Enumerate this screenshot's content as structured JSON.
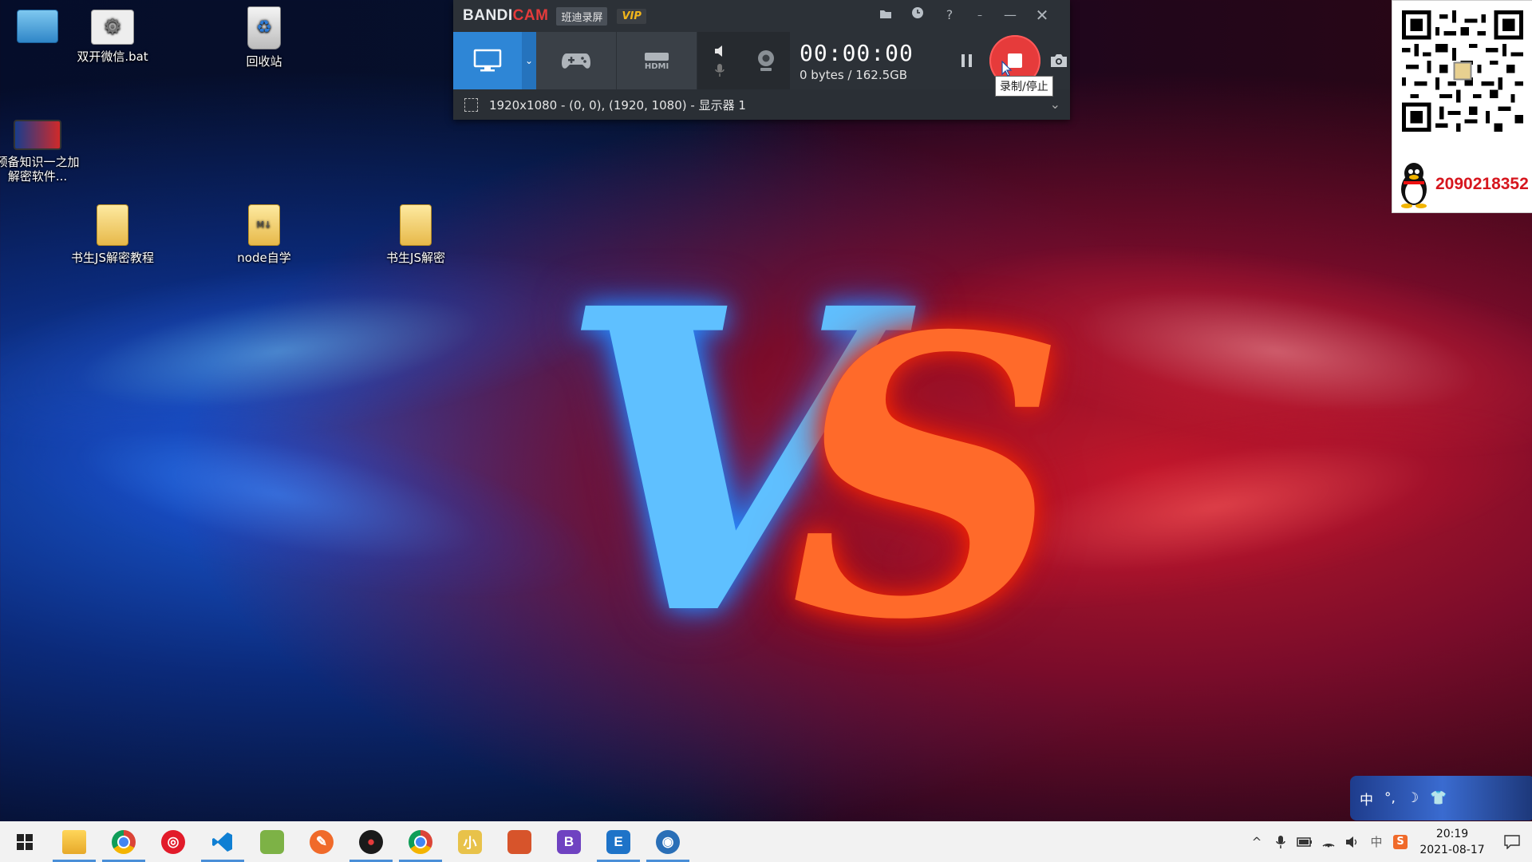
{
  "desktop": {
    "icons": [
      {
        "label": ""
      },
      {
        "label": "双开微信.bat"
      },
      {
        "label": "回收站"
      },
      {
        "label": "预备知识一之加解密软件..."
      },
      {
        "label": "书生JS解密教程"
      },
      {
        "label": "node自学"
      },
      {
        "label": "书生JS解密"
      }
    ],
    "wallpaper_text": "VS"
  },
  "bandicam": {
    "brand_a": "BANDI",
    "brand_b": "CAM",
    "tag": "班迪录屏",
    "vip": "VIP",
    "timer": "00:00:00",
    "size": "0 bytes / 162.5GB",
    "region": "1920x1080 - (0, 0), (1920, 1080) - 显示器 1",
    "tooltip": "录制/停止",
    "modes": [
      "screen-mode",
      "game-mode",
      "hdmi-mode"
    ],
    "hdmi_label": "HDMI"
  },
  "qr_panel": {
    "qq_number": "2090218352"
  },
  "ime": {
    "lang": "中"
  },
  "taskbar": {
    "clock_time": "20:19",
    "clock_date": "2021-08-17",
    "tray_lang": "中",
    "apps": [
      {
        "name": "file-explorer",
        "color": "#f4c430",
        "glyph": "",
        "running": true
      },
      {
        "name": "chrome",
        "color": "#ffffff",
        "glyph": "",
        "running": true
      },
      {
        "name": "netease-music",
        "color": "#e21b2a",
        "glyph": "◎",
        "running": false
      },
      {
        "name": "vscode",
        "color": "#0f7fd3",
        "glyph": "",
        "running": true
      },
      {
        "name": "app-green",
        "color": "#7db246",
        "glyph": "",
        "running": false
      },
      {
        "name": "postman",
        "color": "#f06a2a",
        "glyph": "✎",
        "running": false
      },
      {
        "name": "bandicam",
        "color": "#1a1a1a",
        "glyph": "●",
        "running": true
      },
      {
        "name": "chrome-2",
        "color": "#ffffff",
        "glyph": "",
        "running": true
      },
      {
        "name": "app-yellow",
        "color": "#e8c24a",
        "glyph": "小",
        "running": false
      },
      {
        "name": "app-game",
        "color": "#d7542b",
        "glyph": "",
        "running": false
      },
      {
        "name": "bootstrap",
        "color": "#6f42c1",
        "glyph": "B",
        "running": false
      },
      {
        "name": "editor-e",
        "color": "#1e73c8",
        "glyph": "E",
        "running": true
      },
      {
        "name": "app-blue",
        "color": "#2a6fb7",
        "glyph": "◉",
        "running": true
      }
    ]
  }
}
